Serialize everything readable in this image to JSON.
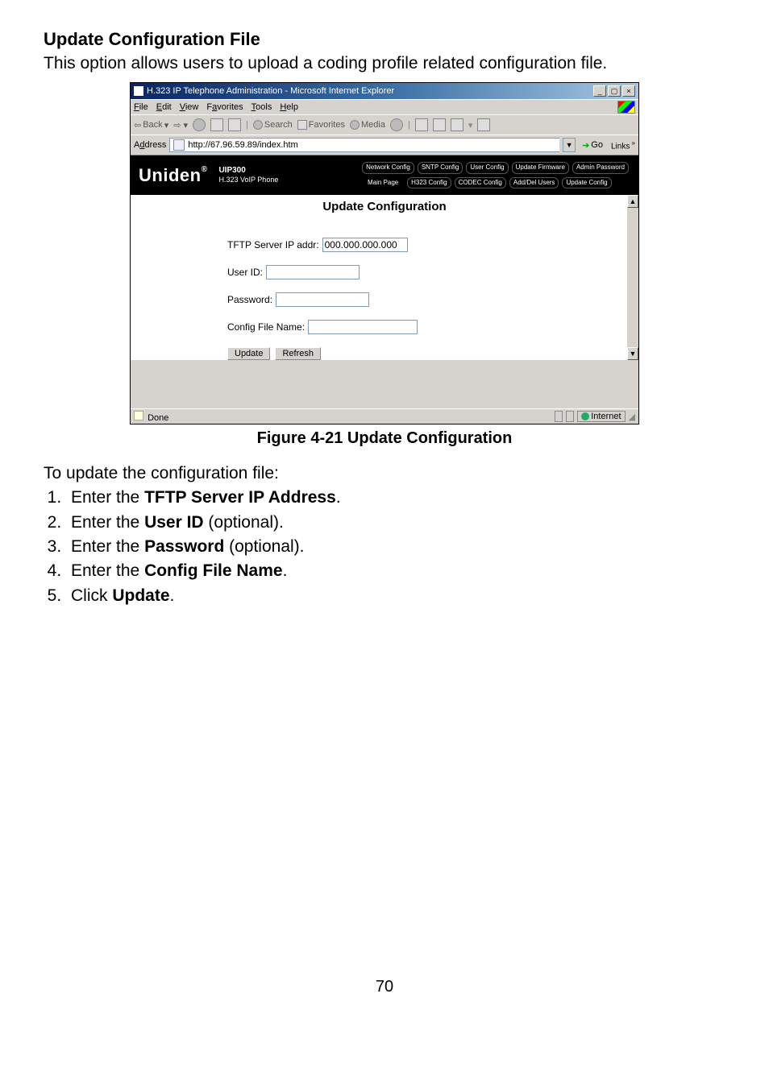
{
  "doc": {
    "heading": "Update Configuration File",
    "intro": "This option allows users to upload a coding profile related configuration file.",
    "caption": "Figure 4-21 Update Configuration",
    "lead": "To update the configuration file:",
    "steps": [
      {
        "pre": "Enter the ",
        "bold": "TFTP Server IP Address",
        "post": "."
      },
      {
        "pre": "Enter the ",
        "bold": "User ID",
        "post": " (optional)."
      },
      {
        "pre": "Enter the ",
        "bold": "Password",
        "post": " (optional)."
      },
      {
        "pre": "Enter the ",
        "bold": "Config File Name",
        "post": "."
      },
      {
        "pre": "Click ",
        "bold": "Update",
        "post": "."
      }
    ],
    "page_number": "70"
  },
  "window": {
    "title": "H.323 IP Telephone Administration - Microsoft Internet Explorer",
    "menus": {
      "file": "File",
      "edit": "Edit",
      "view": "View",
      "favorites": "Favorites",
      "tools": "Tools",
      "help": "Help"
    },
    "toolbar": {
      "back": "Back",
      "search": "Search",
      "favorites": "Favorites",
      "media": "Media"
    },
    "address_label": "Address",
    "address_value": "http://67.96.59.89/index.htm",
    "go_label": "Go",
    "links_label": "Links",
    "status_left": "Done",
    "status_right": "Internet"
  },
  "app": {
    "logo": "Uniden",
    "model_line1": "UIP300",
    "model_line2": "H.323 VoIP Phone",
    "tabs_row1": [
      "Network Config",
      "SNTP Config",
      "User Config",
      "Update Firmware",
      "Admin Password"
    ],
    "tabs_row2": [
      "Main Page",
      "H323 Config",
      "CODEC Config",
      "Add/Del Users",
      "Update Config"
    ],
    "page_title": "Update Configuration",
    "form": {
      "tftp_label": "TFTP Server IP addr:",
      "tftp_value": "000.000.000.000",
      "user_label": "User ID:",
      "user_value": "",
      "pass_label": "Password:",
      "pass_value": "",
      "file_label": "Config File Name:",
      "file_value": "",
      "update_btn": "Update",
      "refresh_btn": "Refresh"
    }
  }
}
